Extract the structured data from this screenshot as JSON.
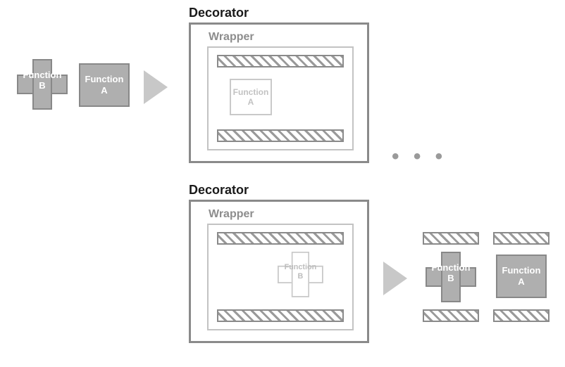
{
  "top": {
    "inputB": "Function\nB",
    "inputA": "Function\nA",
    "decorator_title": "Decorator",
    "wrapper_title": "Wrapper",
    "inner_label": "Function\nA"
  },
  "ellipsis": "• • •",
  "bottom": {
    "decorator_title": "Decorator",
    "wrapper_title": "Wrapper",
    "inner_label": "Function\nB",
    "outB": "Function\nB",
    "outA": "Function\nA"
  }
}
